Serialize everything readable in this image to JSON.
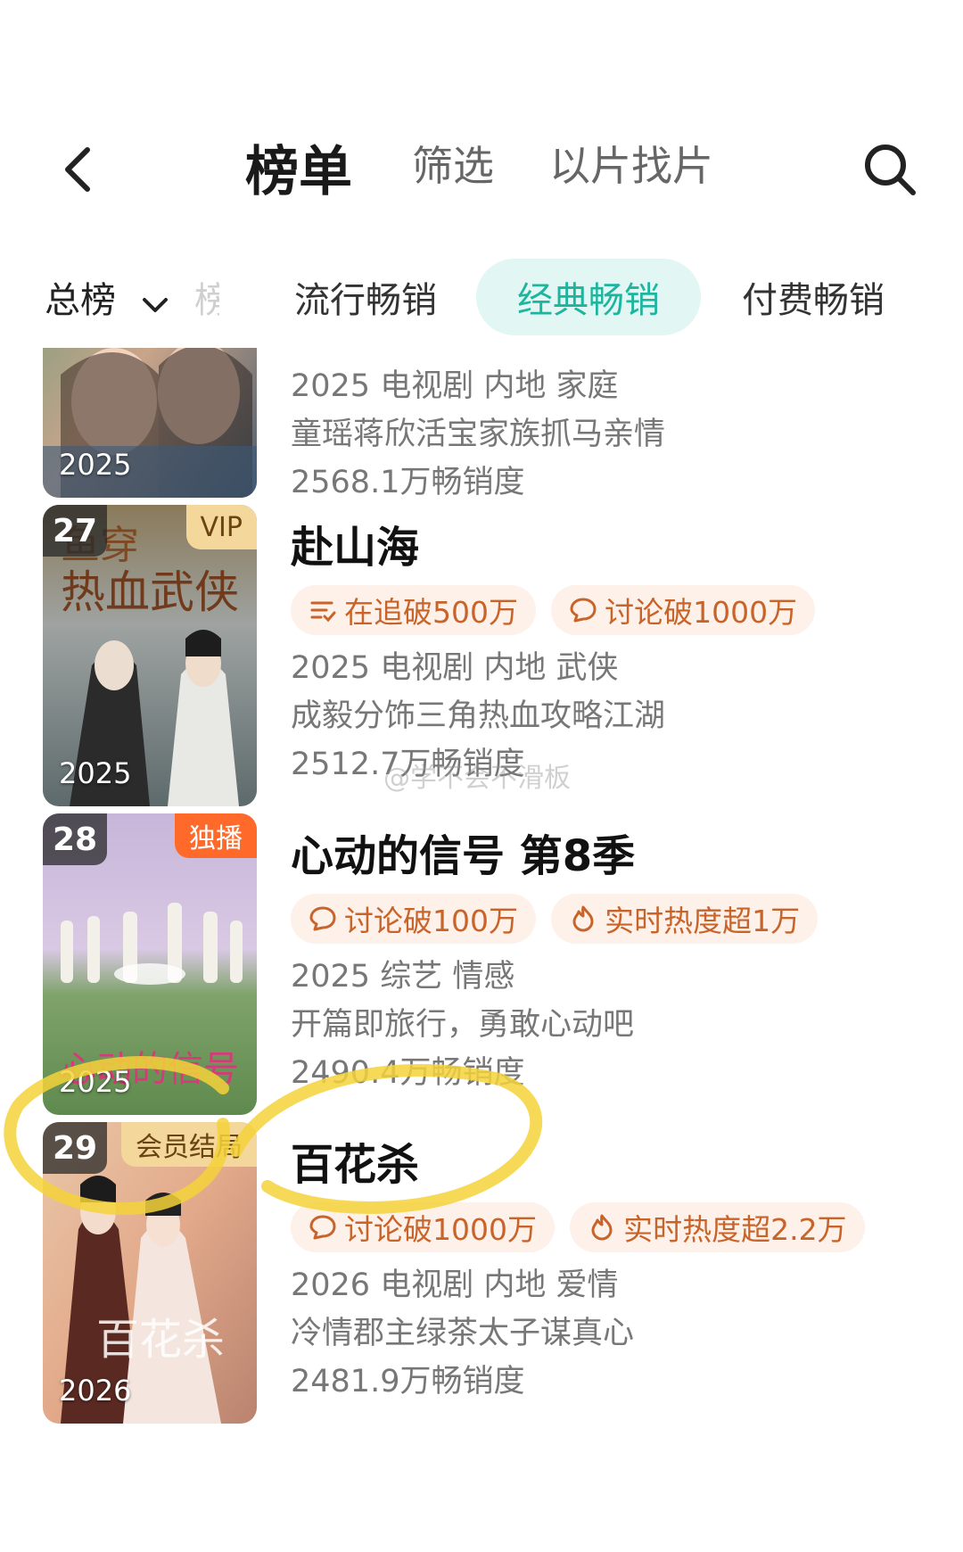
{
  "header": {
    "tabs": [
      {
        "label": "榜单",
        "active": true
      },
      {
        "label": "筛选",
        "active": false
      },
      {
        "label": "以片找片",
        "active": false
      }
    ]
  },
  "subtabs": {
    "dropdown_label": "总榜",
    "partial_label": "榜",
    "items": [
      {
        "label": "流行畅销",
        "selected": false
      },
      {
        "label": "经典畅销",
        "selected": true
      },
      {
        "label": "付费畅销",
        "selected": false
      }
    ]
  },
  "items": [
    {
      "rank": "",
      "badge": "",
      "year": "2025",
      "title": "",
      "tags": [],
      "meta": "2025 电视剧 内地 家庭",
      "desc": "童瑶蒋欣活宝家族抓马亲情",
      "sales": "2568.1万畅销度"
    },
    {
      "rank": "27",
      "badge": "VIP",
      "year": "2025",
      "title": "赴山海",
      "tags": [
        {
          "icon": "list-icon",
          "label": "在追破500万"
        },
        {
          "icon": "comment-icon",
          "label": "讨论破1000万"
        }
      ],
      "meta": "2025 电视剧 内地 武侠",
      "desc": "成毅分饰三角热血攻略江湖",
      "sales": "2512.7万畅销度"
    },
    {
      "rank": "28",
      "badge": "独播",
      "year": "2025",
      "title": "心动的信号 第8季",
      "tags": [
        {
          "icon": "comment-icon",
          "label": "讨论破100万"
        },
        {
          "icon": "fire-icon",
          "label": "实时热度超1万"
        }
      ],
      "meta": "2025 综艺 情感",
      "desc": "开篇即旅行，勇敢心动吧",
      "sales": "2490.4万畅销度"
    },
    {
      "rank": "29",
      "badge": "会员结局",
      "year": "2026",
      "title": "百花杀",
      "tags": [
        {
          "icon": "comment-icon",
          "label": "讨论破1000万"
        },
        {
          "icon": "fire-icon",
          "label": "实时热度超2.2万"
        }
      ],
      "meta": "2026 电视剧 内地 爱情",
      "desc": "冷情郡主绿茶太子谋真心",
      "sales": "2481.9万畅销度"
    }
  ],
  "watermark": "@学不会不滑板",
  "colors": {
    "accent": "#1eb59f",
    "accent_bg": "#e2f6f3",
    "tag_text": "#c8642a",
    "tag_bg": "#fdf1ea",
    "highlight": "#f5d23a"
  }
}
